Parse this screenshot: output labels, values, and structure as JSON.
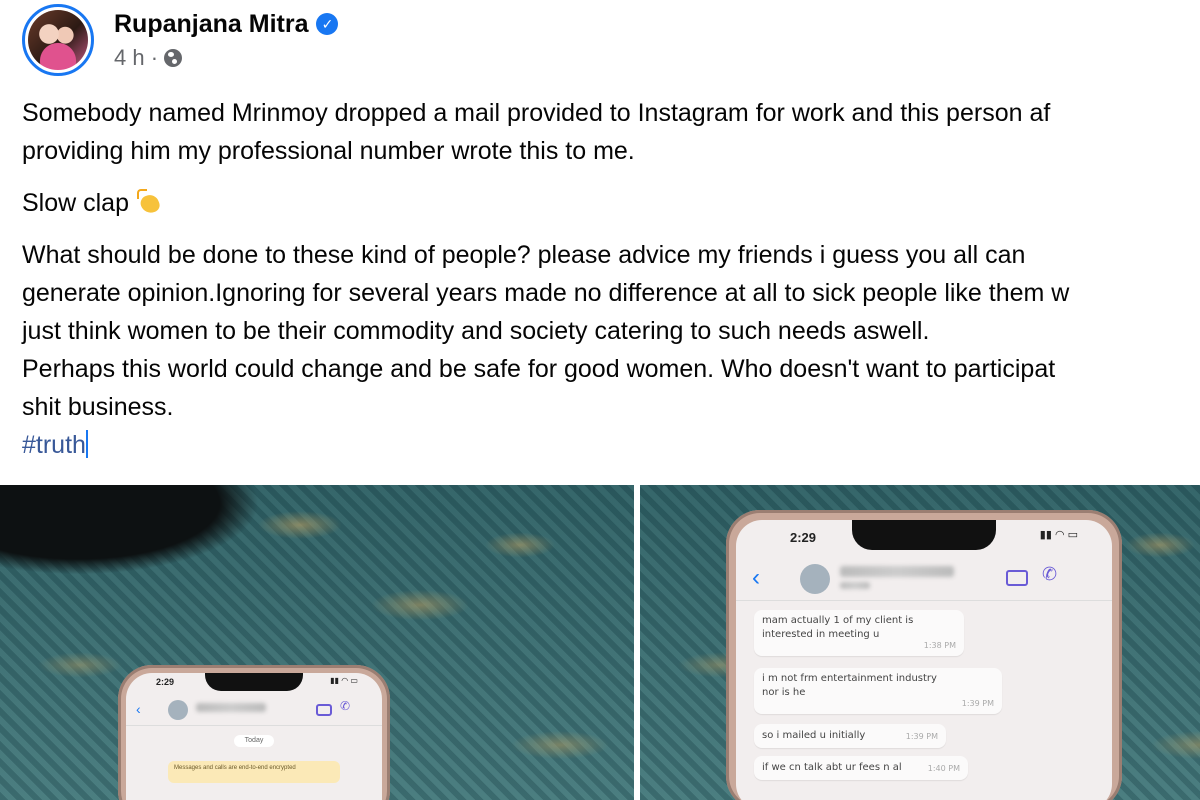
{
  "post": {
    "author": "Rupanjana Mitra",
    "verified": true,
    "time": "4 h ·",
    "privacy_icon": "globe-icon",
    "paragraphs": {
      "p1_line1": "Somebody named Mrinmoy dropped a mail provided to Instagram for work and this person af",
      "p1_line2": "providing him my professional number wrote this to me.",
      "p2": "Slow clap",
      "p3_line1": "What should be done to these kind of people? please advice my friends i guess you all can",
      "p3_line2": "generate opinion.Ignoring for several years made no difference at all to sick people like them w",
      "p3_line3": "just think women to be their commodity and society catering to such needs aswell.",
      "p3_line4": "Perhaps this world could change and be safe for good women. Who doesn't want to participat",
      "p3_line5": "shit business.",
      "hashtag": "#truth"
    }
  },
  "photo_left": {
    "status_time": "2:29",
    "today": "Today",
    "notice": "Messages and calls are end-to-end encrypted"
  },
  "photo_right": {
    "status_time": "2:29",
    "messages": [
      {
        "text1": "mam actually 1 of my client is",
        "text2": "interested in meeting u",
        "time": "1:38 PM"
      },
      {
        "text1": "i m not frm entertainment industry",
        "text2": "nor is he",
        "time": "1:39 PM"
      },
      {
        "text1": "so i mailed u initially",
        "text2": "",
        "time": "1:39 PM"
      },
      {
        "text1": "if we cn talk abt ur fees n al",
        "text2": "",
        "time": "1:40 PM"
      }
    ]
  },
  "colors": {
    "accent": "#1877f2",
    "hashtag": "#385898",
    "secondary_text": "#65676b"
  }
}
